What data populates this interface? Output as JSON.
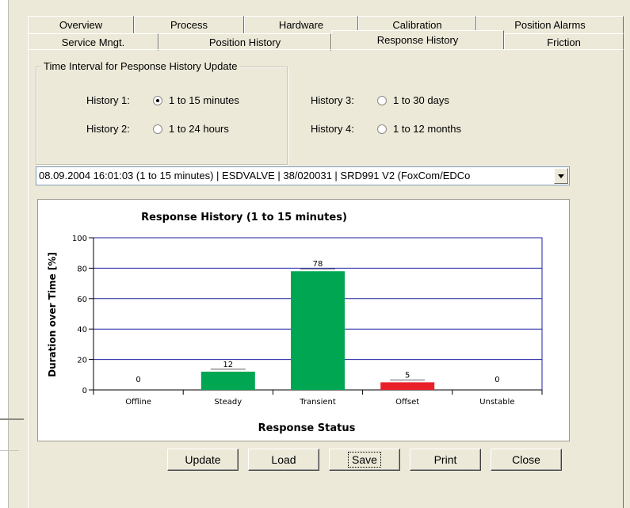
{
  "tabs_row1": [
    "Overview",
    "Process",
    "Hardware",
    "Calibration",
    "Position Alarms"
  ],
  "tabs_row2": [
    "Service Mngt.",
    "Position History",
    "Response History",
    "Friction"
  ],
  "active_tab": "Response History",
  "group": {
    "legend": "Time Interval for Pesponse History Update",
    "histories": [
      {
        "label": "History 1:",
        "option": "1 to 15 minutes",
        "checked": true
      },
      {
        "label": "History 2:",
        "option": "1 to 24 hours",
        "checked": false
      },
      {
        "label": "History 3:",
        "option": "1 to 30 days",
        "checked": false
      },
      {
        "label": "History 4:",
        "option": "1 to 12 months",
        "checked": false
      }
    ]
  },
  "combo_value": "08.09.2004 16:01:03 (1 to 15 minutes) | ESDVALVE | 38/020031 | SRD991 V2 (FoxCom/EDCo",
  "buttons": {
    "update": "Update",
    "load": "Load",
    "save": "Save",
    "print": "Print",
    "close": "Close"
  },
  "chart_data": {
    "type": "bar",
    "title": "Response History (1 to 15 minutes)",
    "xlabel": "Response Status",
    "ylabel": "Duration over Time [%]",
    "categories": [
      "Offline",
      "Steady",
      "Transient",
      "Offset",
      "Unstable"
    ],
    "values": [
      0,
      12,
      78,
      5,
      0
    ],
    "colors": [
      "#00a651",
      "#00a651",
      "#00a651",
      "#e8202a",
      "#00a651"
    ],
    "ylim": [
      0,
      100
    ],
    "yticks": [
      0,
      20,
      40,
      60,
      80,
      100
    ],
    "grid": true
  }
}
